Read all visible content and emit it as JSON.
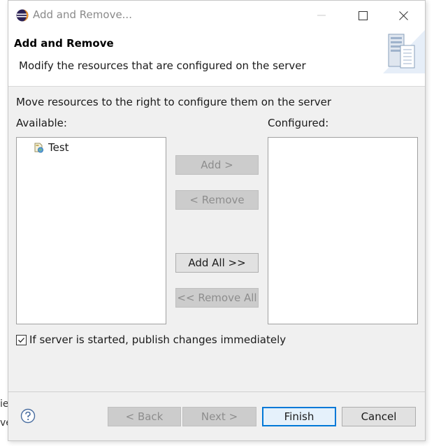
{
  "background": {
    "fragment_top": "ie",
    "fragment_bottom": "ve"
  },
  "window": {
    "title": "Add and Remove...",
    "controls": {
      "minimize_icon": "minimize-icon",
      "maximize_icon": "maximize-icon",
      "close_icon": "close-icon"
    }
  },
  "header": {
    "title": "Add and Remove",
    "description": "Modify the resources that are configured on the server",
    "image_icon": "server-wizard-banner-icon"
  },
  "body": {
    "instruction": "Move resources to the right to configure them on the server",
    "available": {
      "label": "Available:",
      "items": [
        {
          "label": "Test",
          "icon": "web-project-icon"
        }
      ]
    },
    "configured": {
      "label": "Configured:",
      "items": []
    },
    "buttons": {
      "add": "Add >",
      "remove": "< Remove",
      "add_all": "Add All >>",
      "remove_all": "<< Remove All"
    },
    "publish_checkbox": {
      "label": "If server is started, publish changes immediately",
      "checked": true
    }
  },
  "footer": {
    "help_icon": "help-icon",
    "back": "< Back",
    "next": "Next >",
    "finish": "Finish",
    "cancel": "Cancel"
  },
  "colors": {
    "dialog_bg": "#f0f0f0",
    "button_bg": "#e1e1e1",
    "button_disabled_bg": "#cccccc",
    "default_button_border": "#0078d7"
  }
}
